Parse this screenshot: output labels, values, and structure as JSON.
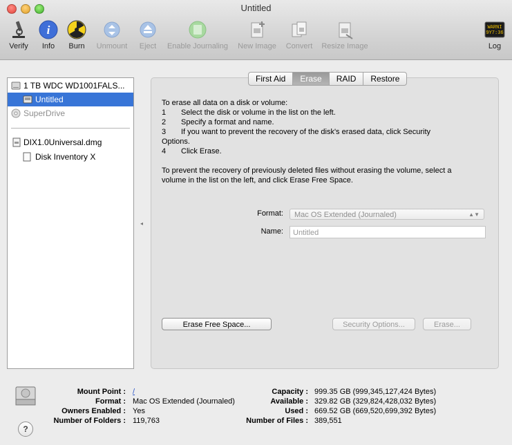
{
  "window": {
    "title": "Untitled"
  },
  "toolbar": {
    "verify": "Verify",
    "info": "Info",
    "burn": "Burn",
    "unmount": "Unmount",
    "eject": "Eject",
    "enable_journaling": "Enable Journaling",
    "new_image": "New Image",
    "convert": "Convert",
    "resize_image": "Resize Image",
    "log": "Log",
    "log_icon_text": [
      "WARNI",
      "9Y7:36"
    ]
  },
  "sidebar": {
    "items": [
      {
        "label": "1 TB WDC WD1001FALS...",
        "icon": "hard-disk-icon"
      },
      {
        "label": "Untitled",
        "icon": "volume-icon",
        "selected": true
      },
      {
        "label": "SuperDrive",
        "icon": "optical-drive-icon",
        "dimmed": true
      },
      {
        "label": "DIX1.0Universal.dmg",
        "icon": "disk-image-icon"
      },
      {
        "label": "Disk Inventory X",
        "icon": "mounted-volume-icon"
      }
    ]
  },
  "tabs": [
    {
      "label": "First Aid"
    },
    {
      "label": "Erase",
      "active": true
    },
    {
      "label": "RAID"
    },
    {
      "label": "Restore"
    }
  ],
  "erase": {
    "intro": "To erase all data on a disk or volume:",
    "steps": [
      {
        "num": "1",
        "text": "Select the disk or volume in the list on the left."
      },
      {
        "num": "2",
        "text": "Specify a format and name."
      },
      {
        "num": "3",
        "text": "If you want to prevent the recovery of the disk's erased data, click Security"
      },
      {
        "num": "",
        "text": "Options."
      },
      {
        "num": "4",
        "text": "Click Erase."
      }
    ],
    "free_space_line1": "To prevent the recovery of previously deleted files without erasing the volume, select a",
    "free_space_line2": "volume in the list on the left, and click Erase Free Space.",
    "format_label": "Format:",
    "format_value": "Mac OS Extended (Journaled)",
    "name_label": "Name:",
    "name_placeholder": "Untitled",
    "erase_free_space": "Erase Free Space...",
    "security_options": "Security Options...",
    "erase_button": "Erase..."
  },
  "info": {
    "left": [
      {
        "label": "Mount Point :",
        "value": "/"
      },
      {
        "label": "Format :",
        "value": "Mac OS Extended (Journaled)"
      },
      {
        "label": "Owners Enabled :",
        "value": "Yes"
      },
      {
        "label": "Number of Folders :",
        "value": "119,763"
      }
    ],
    "right": [
      {
        "label": "Capacity :",
        "value": "999.35 GB (999,345,127,424 Bytes)"
      },
      {
        "label": "Available :",
        "value": "329.82 GB (329,824,428,032 Bytes)"
      },
      {
        "label": "Used :",
        "value": "669.52 GB (669,520,699,392 Bytes)"
      },
      {
        "label": "Number of Files :",
        "value": "389,551"
      }
    ],
    "help": "?"
  }
}
